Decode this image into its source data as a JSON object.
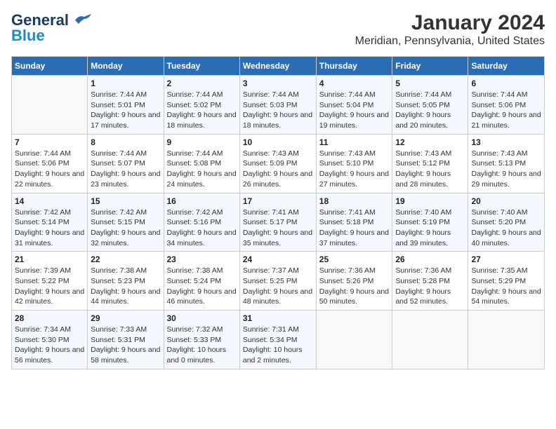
{
  "header": {
    "logo_general": "General",
    "logo_blue": "Blue",
    "title": "January 2024",
    "subtitle": "Meridian, Pennsylvania, United States"
  },
  "weekdays": [
    "Sunday",
    "Monday",
    "Tuesday",
    "Wednesday",
    "Thursday",
    "Friday",
    "Saturday"
  ],
  "weeks": [
    [
      {
        "day": "",
        "sunrise": "",
        "sunset": "",
        "daylight": ""
      },
      {
        "day": "1",
        "sunrise": "Sunrise: 7:44 AM",
        "sunset": "Sunset: 5:01 PM",
        "daylight": "Daylight: 9 hours and 17 minutes."
      },
      {
        "day": "2",
        "sunrise": "Sunrise: 7:44 AM",
        "sunset": "Sunset: 5:02 PM",
        "daylight": "Daylight: 9 hours and 18 minutes."
      },
      {
        "day": "3",
        "sunrise": "Sunrise: 7:44 AM",
        "sunset": "Sunset: 5:03 PM",
        "daylight": "Daylight: 9 hours and 18 minutes."
      },
      {
        "day": "4",
        "sunrise": "Sunrise: 7:44 AM",
        "sunset": "Sunset: 5:04 PM",
        "daylight": "Daylight: 9 hours and 19 minutes."
      },
      {
        "day": "5",
        "sunrise": "Sunrise: 7:44 AM",
        "sunset": "Sunset: 5:05 PM",
        "daylight": "Daylight: 9 hours and 20 minutes."
      },
      {
        "day": "6",
        "sunrise": "Sunrise: 7:44 AM",
        "sunset": "Sunset: 5:06 PM",
        "daylight": "Daylight: 9 hours and 21 minutes."
      }
    ],
    [
      {
        "day": "7",
        "sunrise": "Sunrise: 7:44 AM",
        "sunset": "Sunset: 5:06 PM",
        "daylight": "Daylight: 9 hours and 22 minutes."
      },
      {
        "day": "8",
        "sunrise": "Sunrise: 7:44 AM",
        "sunset": "Sunset: 5:07 PM",
        "daylight": "Daylight: 9 hours and 23 minutes."
      },
      {
        "day": "9",
        "sunrise": "Sunrise: 7:44 AM",
        "sunset": "Sunset: 5:08 PM",
        "daylight": "Daylight: 9 hours and 24 minutes."
      },
      {
        "day": "10",
        "sunrise": "Sunrise: 7:43 AM",
        "sunset": "Sunset: 5:09 PM",
        "daylight": "Daylight: 9 hours and 26 minutes."
      },
      {
        "day": "11",
        "sunrise": "Sunrise: 7:43 AM",
        "sunset": "Sunset: 5:10 PM",
        "daylight": "Daylight: 9 hours and 27 minutes."
      },
      {
        "day": "12",
        "sunrise": "Sunrise: 7:43 AM",
        "sunset": "Sunset: 5:12 PM",
        "daylight": "Daylight: 9 hours and 28 minutes."
      },
      {
        "day": "13",
        "sunrise": "Sunrise: 7:43 AM",
        "sunset": "Sunset: 5:13 PM",
        "daylight": "Daylight: 9 hours and 29 minutes."
      }
    ],
    [
      {
        "day": "14",
        "sunrise": "Sunrise: 7:42 AM",
        "sunset": "Sunset: 5:14 PM",
        "daylight": "Daylight: 9 hours and 31 minutes."
      },
      {
        "day": "15",
        "sunrise": "Sunrise: 7:42 AM",
        "sunset": "Sunset: 5:15 PM",
        "daylight": "Daylight: 9 hours and 32 minutes."
      },
      {
        "day": "16",
        "sunrise": "Sunrise: 7:42 AM",
        "sunset": "Sunset: 5:16 PM",
        "daylight": "Daylight: 9 hours and 34 minutes."
      },
      {
        "day": "17",
        "sunrise": "Sunrise: 7:41 AM",
        "sunset": "Sunset: 5:17 PM",
        "daylight": "Daylight: 9 hours and 35 minutes."
      },
      {
        "day": "18",
        "sunrise": "Sunrise: 7:41 AM",
        "sunset": "Sunset: 5:18 PM",
        "daylight": "Daylight: 9 hours and 37 minutes."
      },
      {
        "day": "19",
        "sunrise": "Sunrise: 7:40 AM",
        "sunset": "Sunset: 5:19 PM",
        "daylight": "Daylight: 9 hours and 39 minutes."
      },
      {
        "day": "20",
        "sunrise": "Sunrise: 7:40 AM",
        "sunset": "Sunset: 5:20 PM",
        "daylight": "Daylight: 9 hours and 40 minutes."
      }
    ],
    [
      {
        "day": "21",
        "sunrise": "Sunrise: 7:39 AM",
        "sunset": "Sunset: 5:22 PM",
        "daylight": "Daylight: 9 hours and 42 minutes."
      },
      {
        "day": "22",
        "sunrise": "Sunrise: 7:38 AM",
        "sunset": "Sunset: 5:23 PM",
        "daylight": "Daylight: 9 hours and 44 minutes."
      },
      {
        "day": "23",
        "sunrise": "Sunrise: 7:38 AM",
        "sunset": "Sunset: 5:24 PM",
        "daylight": "Daylight: 9 hours and 46 minutes."
      },
      {
        "day": "24",
        "sunrise": "Sunrise: 7:37 AM",
        "sunset": "Sunset: 5:25 PM",
        "daylight": "Daylight: 9 hours and 48 minutes."
      },
      {
        "day": "25",
        "sunrise": "Sunrise: 7:36 AM",
        "sunset": "Sunset: 5:26 PM",
        "daylight": "Daylight: 9 hours and 50 minutes."
      },
      {
        "day": "26",
        "sunrise": "Sunrise: 7:36 AM",
        "sunset": "Sunset: 5:28 PM",
        "daylight": "Daylight: 9 hours and 52 minutes."
      },
      {
        "day": "27",
        "sunrise": "Sunrise: 7:35 AM",
        "sunset": "Sunset: 5:29 PM",
        "daylight": "Daylight: 9 hours and 54 minutes."
      }
    ],
    [
      {
        "day": "28",
        "sunrise": "Sunrise: 7:34 AM",
        "sunset": "Sunset: 5:30 PM",
        "daylight": "Daylight: 9 hours and 56 minutes."
      },
      {
        "day": "29",
        "sunrise": "Sunrise: 7:33 AM",
        "sunset": "Sunset: 5:31 PM",
        "daylight": "Daylight: 9 hours and 58 minutes."
      },
      {
        "day": "30",
        "sunrise": "Sunrise: 7:32 AM",
        "sunset": "Sunset: 5:33 PM",
        "daylight": "Daylight: 10 hours and 0 minutes."
      },
      {
        "day": "31",
        "sunrise": "Sunrise: 7:31 AM",
        "sunset": "Sunset: 5:34 PM",
        "daylight": "Daylight: 10 hours and 2 minutes."
      },
      {
        "day": "",
        "sunrise": "",
        "sunset": "",
        "daylight": ""
      },
      {
        "day": "",
        "sunrise": "",
        "sunset": "",
        "daylight": ""
      },
      {
        "day": "",
        "sunrise": "",
        "sunset": "",
        "daylight": ""
      }
    ]
  ]
}
